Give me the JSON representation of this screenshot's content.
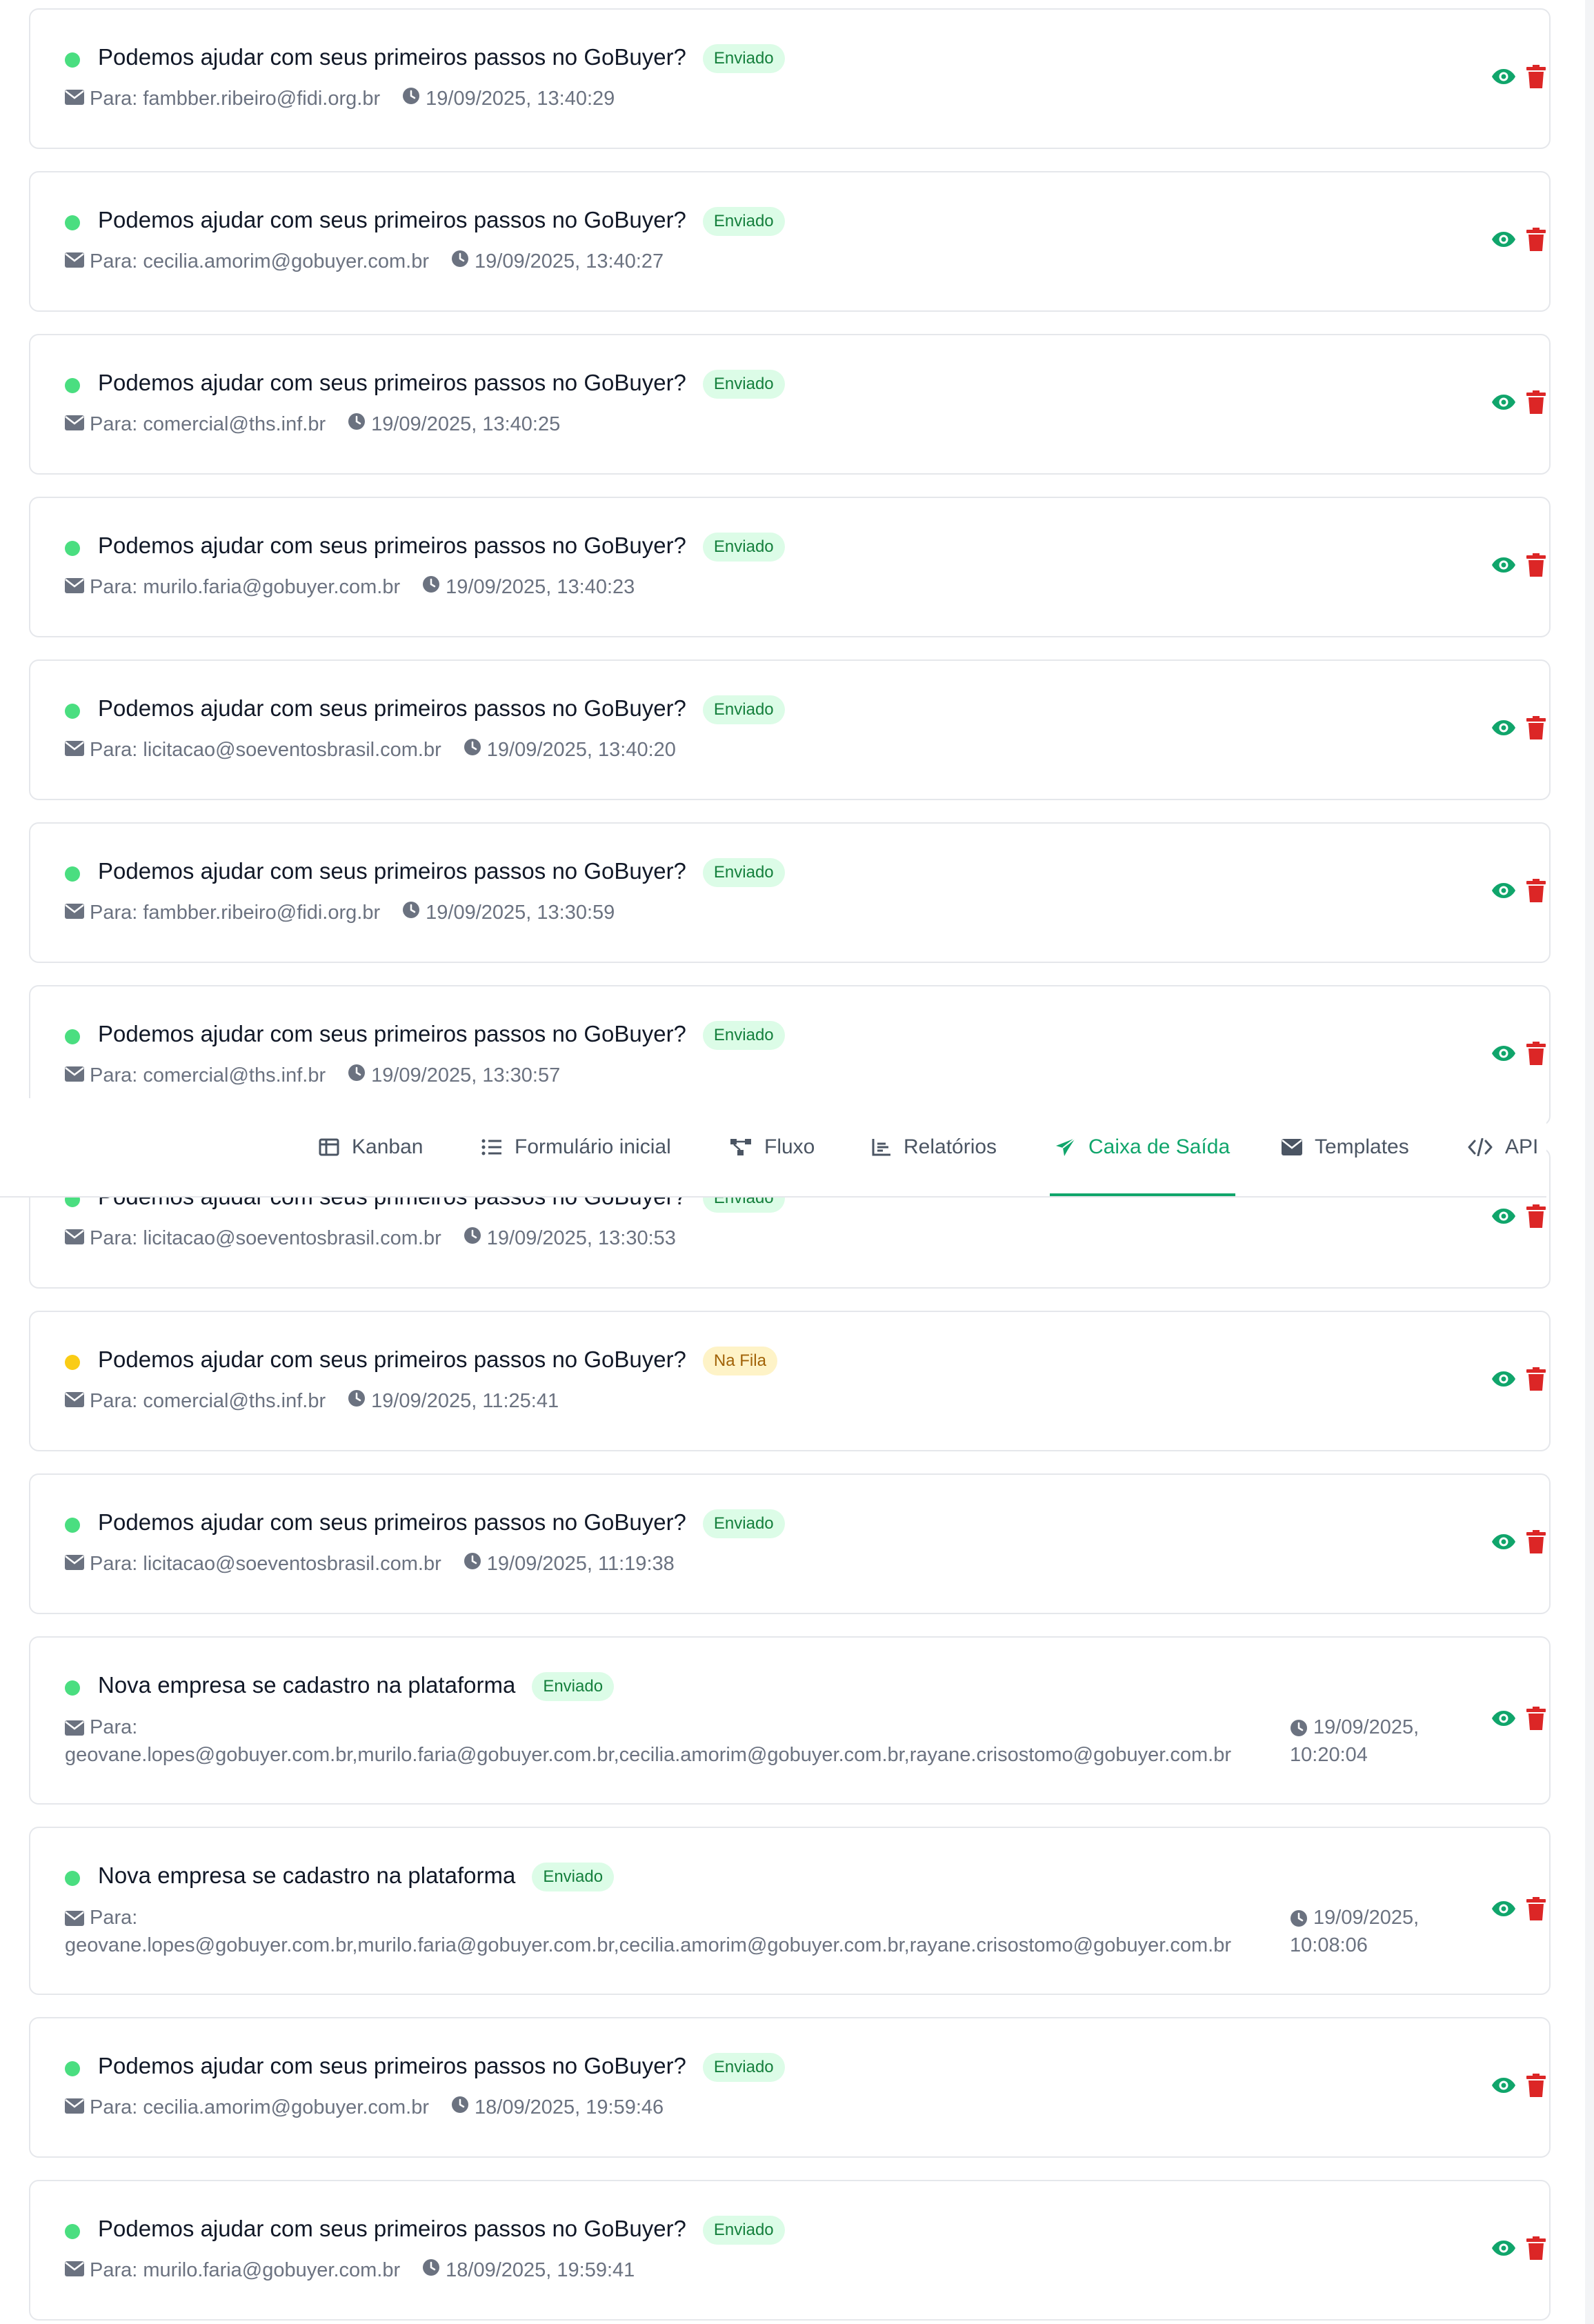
{
  "colors": {
    "sent_dot": "#4ade80",
    "queue_dot": "#facc15",
    "view_icon": "#10a56b",
    "delete_icon": "#dc2626",
    "active_tab": "#10a56b"
  },
  "emails": [
    {
      "subject": "Podemos ajudar com seus primeiros passos no GoBuyer?",
      "status": "Enviado",
      "status_type": "sent",
      "to": "Para: fambber.ribeiro@fidi.org.br",
      "date": "19/09/2025, 13:40:29"
    },
    {
      "subject": "Podemos ajudar com seus primeiros passos no GoBuyer?",
      "status": "Enviado",
      "status_type": "sent",
      "to": "Para: cecilia.amorim@gobuyer.com.br",
      "date": "19/09/2025, 13:40:27"
    },
    {
      "subject": "Podemos ajudar com seus primeiros passos no GoBuyer?",
      "status": "Enviado",
      "status_type": "sent",
      "to": "Para: comercial@ths.inf.br",
      "date": "19/09/2025, 13:40:25"
    },
    {
      "subject": "Podemos ajudar com seus primeiros passos no GoBuyer?",
      "status": "Enviado",
      "status_type": "sent",
      "to": "Para: murilo.faria@gobuyer.com.br",
      "date": "19/09/2025, 13:40:23"
    },
    {
      "subject": "Podemos ajudar com seus primeiros passos no GoBuyer?",
      "status": "Enviado",
      "status_type": "sent",
      "to": "Para: licitacao@soeventosbrasil.com.br",
      "date": "19/09/2025, 13:40:20"
    },
    {
      "subject": "Podemos ajudar com seus primeiros passos no GoBuyer?",
      "status": "Enviado",
      "status_type": "sent",
      "to": "Para: fambber.ribeiro@fidi.org.br",
      "date": "19/09/2025, 13:30:59"
    },
    {
      "subject": "Podemos ajudar com seus primeiros passos no GoBuyer?",
      "status": "Enviado",
      "status_type": "sent",
      "to": "Para: comercial@ths.inf.br",
      "date": "19/09/2025, 13:30:57"
    },
    {
      "subject": "Podemos ajudar com seus primeiros passos no GoBuyer?",
      "status": "Enviado",
      "status_type": "sent",
      "to": "Para: licitacao@soeventosbrasil.com.br",
      "date": "19/09/2025, 13:30:53"
    },
    {
      "subject": "Podemos ajudar com seus primeiros passos no GoBuyer?",
      "status": "Na Fila",
      "status_type": "queue",
      "to": "Para: comercial@ths.inf.br",
      "date": "19/09/2025, 11:25:41"
    },
    {
      "subject": "Podemos ajudar com seus primeiros passos no GoBuyer?",
      "status": "Enviado",
      "status_type": "sent",
      "to": "Para: licitacao@soeventosbrasil.com.br",
      "date": "19/09/2025, 11:19:38"
    },
    {
      "subject": "Nova empresa se cadastro na plataforma",
      "status": "Enviado",
      "status_type": "sent",
      "to_label": "Para:",
      "to_list": "geovane.lopes@gobuyer.com.br,murilo.faria@gobuyer.com.br,cecilia.amorim@gobuyer.com.br,rayane.crisostomo@gobuyer.com.br",
      "date_line1": "19/09/2025,",
      "date_line2": "10:20:04"
    },
    {
      "subject": "Nova empresa se cadastro na plataforma",
      "status": "Enviado",
      "status_type": "sent",
      "to_label": "Para:",
      "to_list": "geovane.lopes@gobuyer.com.br,murilo.faria@gobuyer.com.br,cecilia.amorim@gobuyer.com.br,rayane.crisostomo@gobuyer.com.br",
      "date_line1": "19/09/2025,",
      "date_line2": "10:08:06"
    },
    {
      "subject": "Podemos ajudar com seus primeiros passos no GoBuyer?",
      "status": "Enviado",
      "status_type": "sent",
      "to": "Para: cecilia.amorim@gobuyer.com.br",
      "date": "18/09/2025, 19:59:46"
    },
    {
      "subject": "Podemos ajudar com seus primeiros passos no GoBuyer?",
      "status": "Enviado",
      "status_type": "sent",
      "to": "Para: murilo.faria@gobuyer.com.br",
      "date": "18/09/2025, 19:59:41"
    }
  ],
  "nav": {
    "tabs": [
      {
        "label": "Kanban",
        "icon": "kanban-icon"
      },
      {
        "label": "Formulário inicial",
        "icon": "list-icon"
      },
      {
        "label": "Fluxo",
        "icon": "flow-icon"
      },
      {
        "label": "Relatórios",
        "icon": "chart-icon"
      },
      {
        "label": "Caixa de Saída",
        "icon": "send-icon",
        "active": true
      },
      {
        "label": "Templates",
        "icon": "envelope-icon"
      },
      {
        "label": "API",
        "icon": "code-icon"
      }
    ]
  }
}
